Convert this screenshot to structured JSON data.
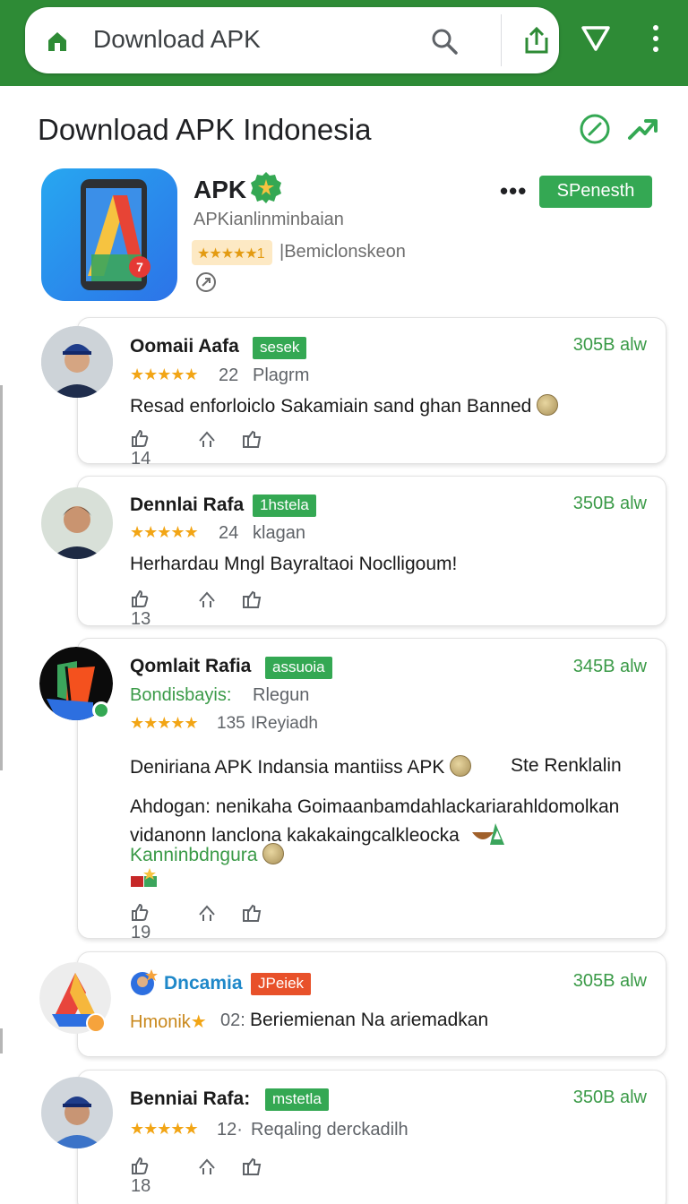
{
  "browser": {
    "url_text": "Download APK"
  },
  "page": {
    "title": "Download APK Indonesia"
  },
  "app": {
    "name": "APK",
    "developer": "APKianlinminbaian",
    "rating_chip": "★★★★★1",
    "rating_label": "|Bemiclonskeon",
    "icon_badge": "7",
    "action_label": "SPenesth",
    "more_label": "•••"
  },
  "reviews": [
    {
      "name": "Oomaii Aafa",
      "tag": "sesek",
      "time": "305B alw",
      "stars": "★★★★★",
      "count": "22",
      "meta": "Plagrm",
      "text": "Resad enforloiclo Sakamiain sand ghan Banned",
      "likes": "14"
    },
    {
      "name": "Dennlai Rafa",
      "tag": "1hstela",
      "time": "350B alw",
      "stars": "★★★★★",
      "count": "24",
      "meta": "klagan",
      "text": "Herhardau Mngl Bayraltaoi Noclligoum!",
      "likes": "13"
    },
    {
      "name": "Qomlait Rafia",
      "tag": "assuoia",
      "time": "345B alw",
      "subtitle": "Bondisbayis:",
      "subtitle2": "Rlegun",
      "stars": "★★★★★",
      "count": "135",
      "meta": "IReyiadh",
      "text": "Deniriana APK Indansia mantiiss APK",
      "text_extra": "Ste Renklalin",
      "line2": "Ahdogan: nenikaha Goimaanbamdahlackariarahldomolkan",
      "line3": "vidanonn lanclona kakakaingcalkleocka",
      "line4": "Kanninbdngura",
      "likes": "19"
    },
    {
      "name": "Dncamia",
      "tag": "JPeiek",
      "time": "305B alw",
      "label": "Hmonik",
      "star": "★",
      "count": "02:",
      "text": "Beriemienan Na ariemadkan"
    },
    {
      "name": "Benniai Rafa:",
      "tag": "mstetla",
      "time": "350B alw",
      "stars": "★★★★★",
      "count": "12·",
      "meta": "Reqaling derckadilh",
      "likes": "18"
    }
  ],
  "colors": {
    "brand_green": "#2e8b36",
    "accent_green": "#34a853",
    "star": "#f2a515",
    "tag_red": "#e8512a"
  }
}
